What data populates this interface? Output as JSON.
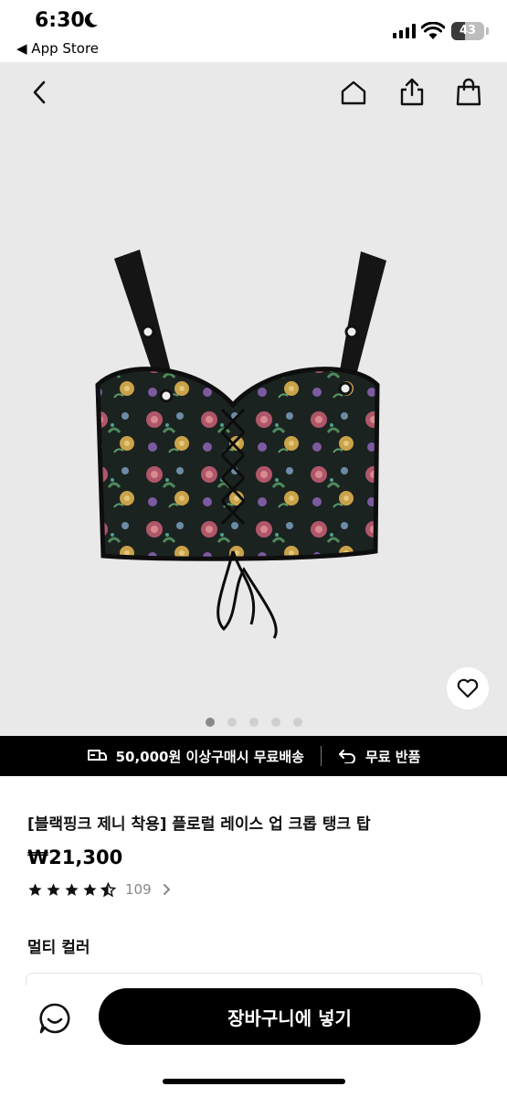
{
  "status_bar": {
    "time": "6:30",
    "back_to_app": "◀ App Store",
    "battery": "43",
    "battery_level_percent": 43
  },
  "top_nav": {
    "back_icon": "chevron-left-icon",
    "home_icon": "home-icon",
    "share_icon": "share-icon",
    "bag_icon": "shopping-bag-icon"
  },
  "gallery": {
    "total_images": 5,
    "active_index": 0
  },
  "banner": {
    "shipping_text": "50,000원 이상구매시 무료배송",
    "return_text": "무료 반품"
  },
  "product": {
    "title": "[블랙핑크 제니 착용] 플로럴 레이스 업 크롭 탱크 탑",
    "price": "₩21,300",
    "rating_stars": 4.5,
    "review_count": "109",
    "color_label": "멀티 컬러"
  },
  "bottom_bar": {
    "add_to_cart": "장바구니에 넣기"
  },
  "colors": {
    "hero_bg": "#e9e9e9",
    "banner_bg": "#000000",
    "cta_bg": "#000000"
  }
}
